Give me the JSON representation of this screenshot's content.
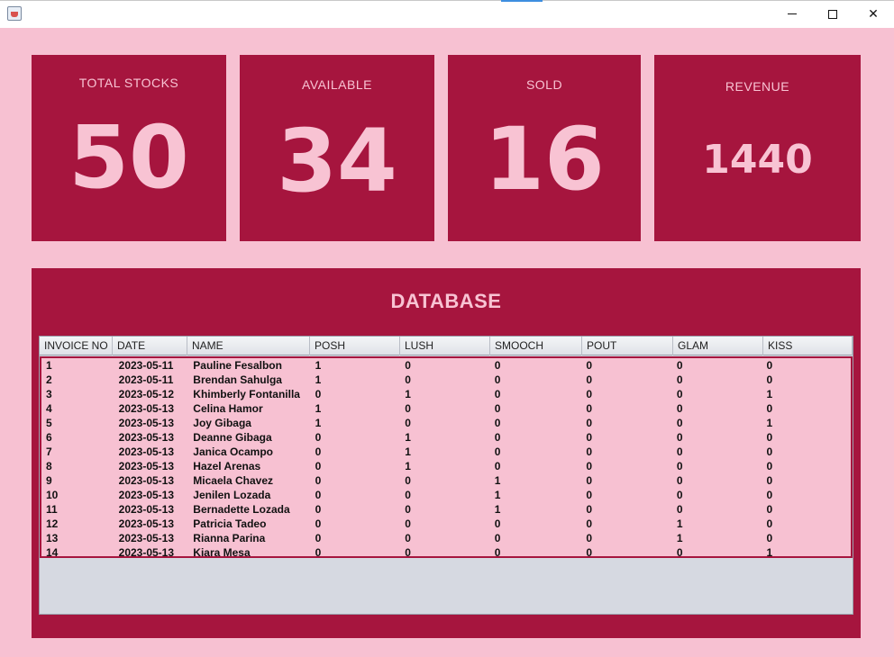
{
  "window": {
    "icon": "java-coffee-cup-icon",
    "buttons": {
      "minimize": "minimize-icon",
      "maximize": "maximize-icon",
      "close": "close-icon"
    }
  },
  "stats": [
    {
      "label": "TOTAL STOCKS",
      "value": "50"
    },
    {
      "label": "AVAILABLE",
      "value": "34"
    },
    {
      "label": "SOLD",
      "value": "16"
    },
    {
      "label": "REVENUE",
      "value": "1440"
    }
  ],
  "database": {
    "title": "DATABASE",
    "columns": [
      "INVOICE NO",
      "DATE",
      "NAME",
      "POSH",
      "LUSH",
      "SMOOCH",
      "POUT",
      "GLAM",
      "KISS"
    ],
    "rows": [
      [
        "1",
        "2023-05-11",
        "Pauline Fesalbon",
        "1",
        "0",
        "0",
        "0",
        "0",
        "0"
      ],
      [
        "2",
        "2023-05-11",
        "Brendan Sahulga",
        "1",
        "0",
        "0",
        "0",
        "0",
        "0"
      ],
      [
        "3",
        "2023-05-12",
        "Khimberly Fontanilla",
        "0",
        "1",
        "0",
        "0",
        "0",
        "1"
      ],
      [
        "4",
        "2023-05-13",
        "Celina Hamor",
        "1",
        "0",
        "0",
        "0",
        "0",
        "0"
      ],
      [
        "5",
        "2023-05-13",
        "Joy Gibaga",
        "1",
        "0",
        "0",
        "0",
        "0",
        "1"
      ],
      [
        "6",
        "2023-05-13",
        "Deanne Gibaga",
        "0",
        "1",
        "0",
        "0",
        "0",
        "0"
      ],
      [
        "7",
        "2023-05-13",
        "Janica Ocampo",
        "0",
        "1",
        "0",
        "0",
        "0",
        "0"
      ],
      [
        "8",
        "2023-05-13",
        "Hazel Arenas",
        "0",
        "1",
        "0",
        "0",
        "0",
        "0"
      ],
      [
        "9",
        "2023-05-13",
        "Micaela Chavez",
        "0",
        "0",
        "1",
        "0",
        "0",
        "0"
      ],
      [
        "10",
        "2023-05-13",
        "Jenilen Lozada",
        "0",
        "0",
        "1",
        "0",
        "0",
        "0"
      ],
      [
        "11",
        "2023-05-13",
        "Bernadette Lozada",
        "0",
        "0",
        "1",
        "0",
        "0",
        "0"
      ],
      [
        "12",
        "2023-05-13",
        "Patricia Tadeo",
        "0",
        "0",
        "0",
        "0",
        "1",
        "0"
      ],
      [
        "13",
        "2023-05-13",
        "Rianna Parina",
        "0",
        "0",
        "0",
        "0",
        "1",
        "0"
      ],
      [
        "14",
        "2023-05-13",
        "Kiara Mesa",
        "0",
        "0",
        "0",
        "0",
        "0",
        "1"
      ]
    ]
  },
  "colors": {
    "background": "#f7c1d2",
    "panel": "#a6153e",
    "accent_text": "#f8c3d3"
  }
}
